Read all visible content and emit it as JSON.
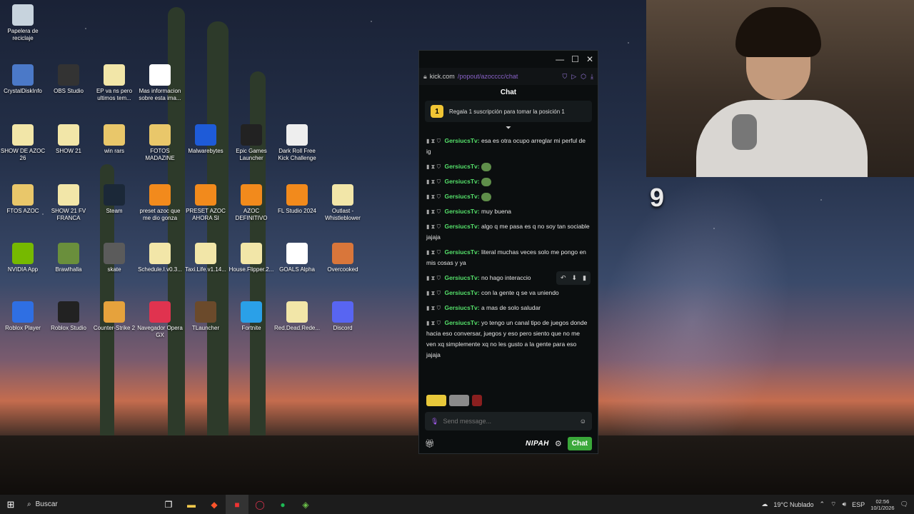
{
  "desktop": {
    "icons": [
      {
        "label": "Papelera de reciclaje",
        "icon": "recycle-bin-icon",
        "color": "#c7d3dd"
      },
      {
        "label": "CrystalDiskInfo",
        "icon": "crystaldisk-icon",
        "color": "#4b79c8"
      },
      {
        "label": "OBS Studio",
        "icon": "obs-icon",
        "color": "#333333"
      },
      {
        "label": "EP va ns pero ultimos tem...",
        "icon": "file-icon",
        "color": "#f2e6a8"
      },
      {
        "label": "Mas informacion sobre esta ima...",
        "icon": "info-icon",
        "color": "#ffffff"
      },
      {
        "label": "SHOW DE AZOC 26",
        "icon": "file-icon",
        "color": "#f2e6a8"
      },
      {
        "label": "SHOW 21",
        "icon": "file-icon",
        "color": "#f2e6a8"
      },
      {
        "label": "win rars",
        "icon": "folder-icon",
        "color": "#e9c76a"
      },
      {
        "label": "FOTOS MADAZINE",
        "icon": "folder-icon",
        "color": "#e9c76a"
      },
      {
        "label": "Malwarebytes",
        "icon": "malwarebytes-icon",
        "color": "#1e5bd8"
      },
      {
        "label": "Epic Games Launcher",
        "icon": "epic-icon",
        "color": "#222222"
      },
      {
        "label": "Dark Roll Free Kick Challenge",
        "icon": "ball-icon",
        "color": "#eeeeee"
      },
      {
        "label": "FTOS AZOC",
        "icon": "folder-icon",
        "color": "#e9c76a"
      },
      {
        "label": "SHOW 21 FV FRANCA",
        "icon": "file-icon",
        "color": "#f2e6a8"
      },
      {
        "label": "Steam",
        "icon": "steam-icon",
        "color": "#1b2838"
      },
      {
        "label": "preset azoc que me dio gonza",
        "icon": "fl-studio-icon",
        "color": "#f28a1c"
      },
      {
        "label": "PRESET AZOC AHORA SI",
        "icon": "fl-studio-icon",
        "color": "#f28a1c"
      },
      {
        "label": "AZOC DEFINITIVO",
        "icon": "fl-studio-icon",
        "color": "#f28a1c"
      },
      {
        "label": "FL Studio 2024",
        "icon": "fl-studio-icon",
        "color": "#f28a1c"
      },
      {
        "label": "Outlast - Whistleblower",
        "icon": "file-icon",
        "color": "#f2e6a8"
      },
      {
        "label": "NVIDIA App",
        "icon": "nvidia-icon",
        "color": "#76b900"
      },
      {
        "label": "Brawlhalla",
        "icon": "brawlhalla-icon",
        "color": "#6a8f3c"
      },
      {
        "label": "skate",
        "icon": "skate-icon",
        "color": "#5b5b5b"
      },
      {
        "label": "Schedule.I.v0.3...",
        "icon": "file-icon",
        "color": "#f2e6a8"
      },
      {
        "label": "Taxi.Life.v1.14...",
        "icon": "file-icon",
        "color": "#f2e6a8"
      },
      {
        "label": "House.Flipper.2...",
        "icon": "file-icon",
        "color": "#f2e6a8"
      },
      {
        "label": "GOALS Alpha",
        "icon": "goals-icon",
        "color": "#ffffff"
      },
      {
        "label": "Overcooked",
        "icon": "overcooked-icon",
        "color": "#d9763a"
      },
      {
        "label": "Roblox Player",
        "icon": "roblox-icon",
        "color": "#2f6fe3"
      },
      {
        "label": "Roblox Studio",
        "icon": "roblox-studio-icon",
        "color": "#222222"
      },
      {
        "label": "Counter-Strike 2",
        "icon": "cs2-icon",
        "color": "#e6a23c"
      },
      {
        "label": "Navegador Opera GX",
        "icon": "opera-gx-icon",
        "color": "#e0334f"
      },
      {
        "label": "TLauncher",
        "icon": "minecraft-icon",
        "color": "#6b4a2b"
      },
      {
        "label": "Fortnite",
        "icon": "fortnite-icon",
        "color": "#2aa0e8"
      },
      {
        "label": "Red.Dead.Rede...",
        "icon": "file-icon",
        "color": "#f2e6a8"
      },
      {
        "label": "Discord",
        "icon": "discord-icon",
        "color": "#5865f2"
      }
    ]
  },
  "chat_window": {
    "url_host": "kick.com",
    "url_path": "/popout/azocccc/chat",
    "title": "Chat",
    "sub_banner": {
      "badge": "1",
      "text": "Regala 1 suscripción para tomar la posición 1"
    },
    "messages": [
      {
        "user": "GersiucsTv:",
        "text": "esa es otra ocupo arreglar mi perful de ig"
      },
      {
        "user": "GersiucsTv:",
        "text": "",
        "emote": true
      },
      {
        "user": "GersiucsTv:",
        "text": "",
        "emote": true
      },
      {
        "user": "GersiucsTv:",
        "text": "",
        "emote": true
      },
      {
        "user": "GersiucsTv:",
        "text": "muy buena"
      },
      {
        "user": "GersiucsTv:",
        "text": "algo q me pasa es q no soy tan sociable jajaja"
      },
      {
        "user": "GersiucsTv:",
        "text": "literal muchas veces solo me pongo en mis cosas y ya"
      },
      {
        "user": "GersiucsTv:",
        "text": "no hago interaccio"
      },
      {
        "user": "GersiucsTv:",
        "text": "con la gente q se va uniendo"
      },
      {
        "user": "GersiucsTv:",
        "text": "a mas de solo saludar"
      },
      {
        "user": "GersiucsTv:",
        "text": "yo tengo un canal tipo de juegos donde hacia eso conversar, juegos y eso pero siento que no me ven xq simplemente xq no les gusto a la gente para eso jajaja"
      }
    ],
    "input_placeholder": "Send message...",
    "brand": "NIPAH",
    "send_label": "Chat"
  },
  "overlay": {
    "counter": "9"
  },
  "taskbar": {
    "search_label": "Buscar",
    "weather": "19°C Nublado",
    "language": "ESP",
    "time": "02:56",
    "date": "10/1/2026"
  }
}
